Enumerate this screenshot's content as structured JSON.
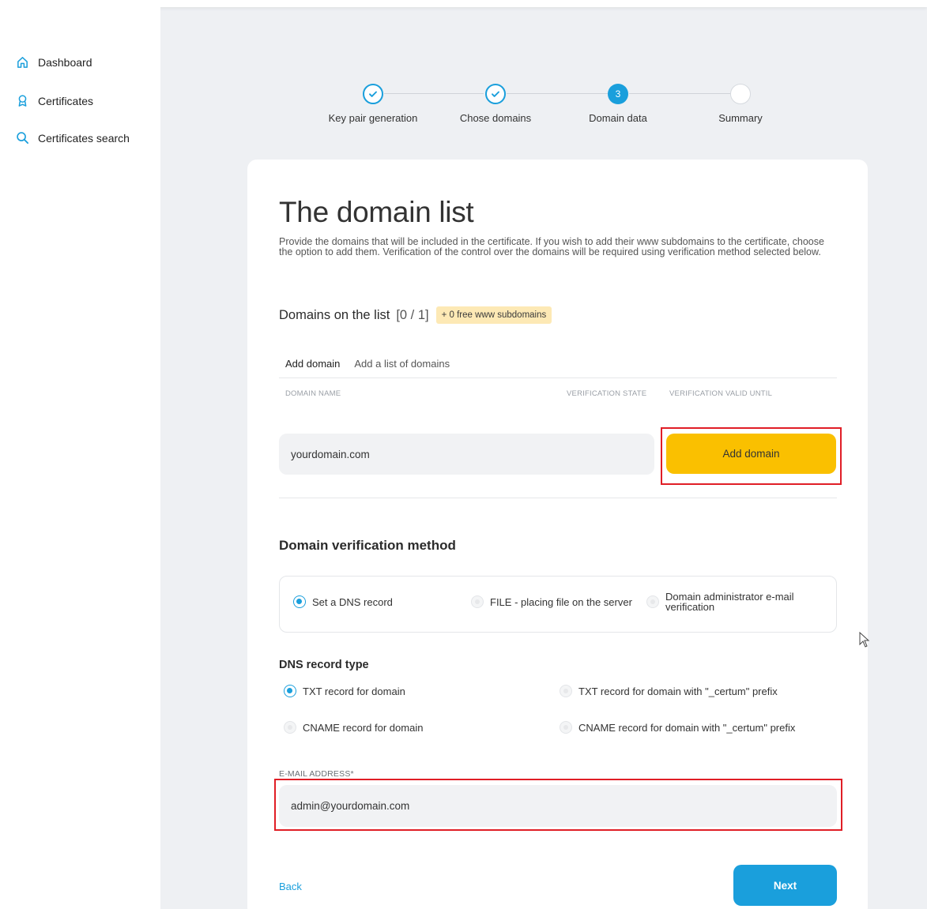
{
  "sidebar": {
    "items": [
      {
        "label": "Dashboard",
        "icon": "home-icon"
      },
      {
        "label": "Certificates",
        "icon": "award-icon"
      },
      {
        "label": "Certificates search",
        "icon": "search-icon"
      }
    ]
  },
  "stepper": {
    "steps": [
      {
        "label": "Key pair generation",
        "state": "done"
      },
      {
        "label": "Chose domains",
        "state": "done"
      },
      {
        "label": "Domain data",
        "state": "active",
        "number": "3"
      },
      {
        "label": "Summary",
        "state": "todo"
      }
    ]
  },
  "main": {
    "title": "The domain list",
    "intro": "Provide the domains that will be included in the certificate. If you wish to add their www subdomains to the certificate, choose the option to add them. Verification of the control over the domains will be required using verification method selected below.",
    "domains_heading": "Domains on the list",
    "domains_count": "[0 / 1]",
    "free_badge": "+ 0 free www subdomains",
    "tabs": [
      "Add domain",
      "Add a list of domains"
    ],
    "columns": [
      "DOMAIN NAME",
      "VERIFICATION STATE",
      "VERIFICATION VALID UNTIL"
    ],
    "domain_input": {
      "value": "yourdomain.com"
    },
    "add_domain_button": "Add domain",
    "verification": {
      "heading": "Domain verification method",
      "options": [
        {
          "label": "Set a DNS record",
          "selected": true
        },
        {
          "label": "FILE - placing file on the server",
          "selected": false
        },
        {
          "label": "Domain administrator e-mail verification",
          "selected": false
        }
      ]
    },
    "dns": {
      "heading": "DNS record type",
      "options": [
        {
          "label": "TXT record for domain",
          "selected": true
        },
        {
          "label": "TXT record for domain with \"_certum\" prefix",
          "selected": false
        },
        {
          "label": "CNAME record for domain",
          "selected": false
        },
        {
          "label": "CNAME record for domain with \"_certum\" prefix",
          "selected": false
        }
      ]
    },
    "email": {
      "label": "E-MAIL ADDRESS*",
      "value": "admin@yourdomain.com"
    },
    "back": "Back",
    "next": "Next"
  },
  "colors": {
    "accent": "#1a9fdc",
    "yellow": "#fac000",
    "highlight": "#e01e26"
  }
}
